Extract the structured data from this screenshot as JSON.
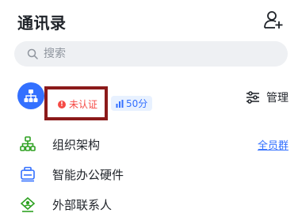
{
  "header": {
    "title": "通讯录"
  },
  "search": {
    "placeholder": "搜索"
  },
  "organization": {
    "status_badge": "未认证",
    "score_badge": "50分",
    "manage_label": "管理"
  },
  "list": {
    "items": [
      {
        "label": "组织架构",
        "icon": "org-structure-icon",
        "action": "全员群"
      },
      {
        "label": "智能办公硬件",
        "icon": "office-hardware-icon"
      },
      {
        "label": "外部联系人",
        "icon": "external-contacts-icon"
      }
    ]
  },
  "colors": {
    "accent": "#3370ff",
    "green": "#2ea121",
    "warning": "#f54a45",
    "highlight_border": "#8b1a1a"
  }
}
